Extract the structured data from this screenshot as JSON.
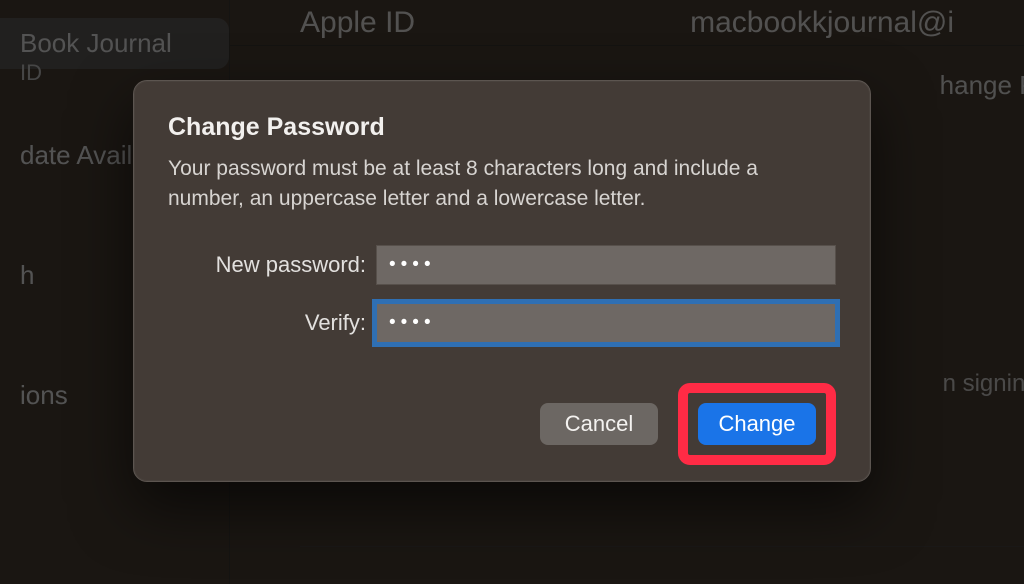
{
  "bg": {
    "sidebar": {
      "selected_title": "Book Journal",
      "selected_sub": "ID",
      "update": "date Availa",
      "bluetooth": "h",
      "notifications": "ions"
    },
    "header": {
      "left": "Apple ID",
      "right": "macbookkjournal@i"
    },
    "change_pass_btn": "hange Pas",
    "signing_note": "n signing in"
  },
  "dialog": {
    "title": "Change Password",
    "description": "Your password must be at least 8 characters long and include a number, an uppercase letter and a lowercase letter.",
    "new_password_label": "New password:",
    "verify_label": "Verify:",
    "new_password_value": "••••",
    "verify_value": "••••",
    "cancel": "Cancel",
    "change": "Change"
  }
}
